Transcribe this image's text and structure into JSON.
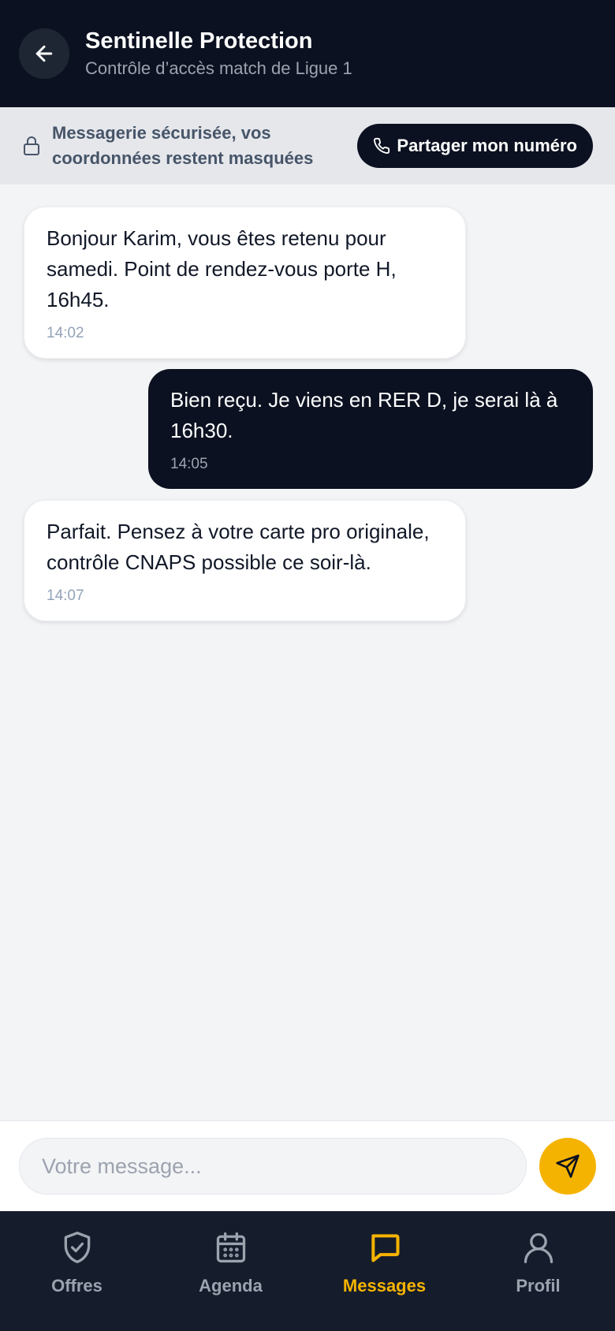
{
  "header": {
    "title": "Sentinelle Protection",
    "subtitle": "Contrôle d’accès match de Ligue 1",
    "back_icon": "arrow-left-icon"
  },
  "banner": {
    "text": "Messagerie sécurisée, vos coordonnées restent masquées",
    "share_label": "Partager mon numéro",
    "lock_icon": "lock-icon",
    "phone_icon": "phone-icon"
  },
  "messages": [
    {
      "direction": "in",
      "text": "Bonjour Karim, vous êtes retenu pour samedi. Point de rendez-vous porte H, 16h45.",
      "time": "14:02"
    },
    {
      "direction": "out",
      "text": "Bien reçu. Je viens en RER D, je serai là à 16h30.",
      "time": "14:05"
    },
    {
      "direction": "in",
      "text": "Parfait. Pensez à votre carte pro originale, contrôle CNAPS possible ce soir-là.",
      "time": "14:07"
    }
  ],
  "composer": {
    "placeholder": "Votre message...",
    "value": "",
    "send_icon": "send-icon"
  },
  "nav": {
    "items": [
      {
        "label": "Offres",
        "icon": "shield-check-icon",
        "active": false
      },
      {
        "label": "Agenda",
        "icon": "calendar-icon",
        "active": false
      },
      {
        "label": "Messages",
        "icon": "chat-icon",
        "active": true
      },
      {
        "label": "Profil",
        "icon": "user-icon",
        "active": false
      }
    ]
  },
  "colors": {
    "header_bg": "#0b1120",
    "accent": "#f5b301",
    "nav_bg": "#151c2c",
    "banner_bg": "#e5e7eb"
  }
}
